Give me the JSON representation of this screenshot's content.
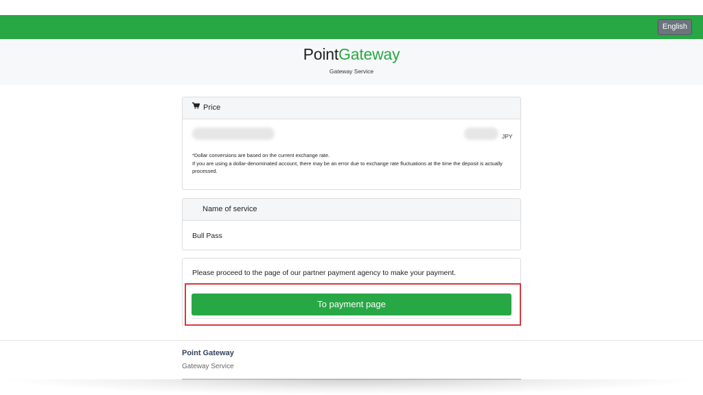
{
  "topbar": {
    "language_button": "English",
    "color": "#28a745"
  },
  "header": {
    "logo_part1": "Point",
    "logo_part2": "Gateway",
    "subtitle": "Gateway Service"
  },
  "price": {
    "title": "Price",
    "icon": "cart-icon",
    "currency": "JPY",
    "note_line1": "*Dollar conversions are based on the current exchange rate.",
    "note_line2": "If you are using a dollar-denominated account, there may be an error due to exchange rate fluctuations at the time the deposit is actually processed."
  },
  "service": {
    "title": "Name of service",
    "value": "Bull Pass"
  },
  "payment": {
    "instruction": "Please proceed to the page of our partner payment agency to make your payment.",
    "button_label": "To payment page",
    "highlight_color": "#d9363e"
  },
  "footer": {
    "title": "Point Gateway",
    "subtitle": "Gateway Service"
  }
}
